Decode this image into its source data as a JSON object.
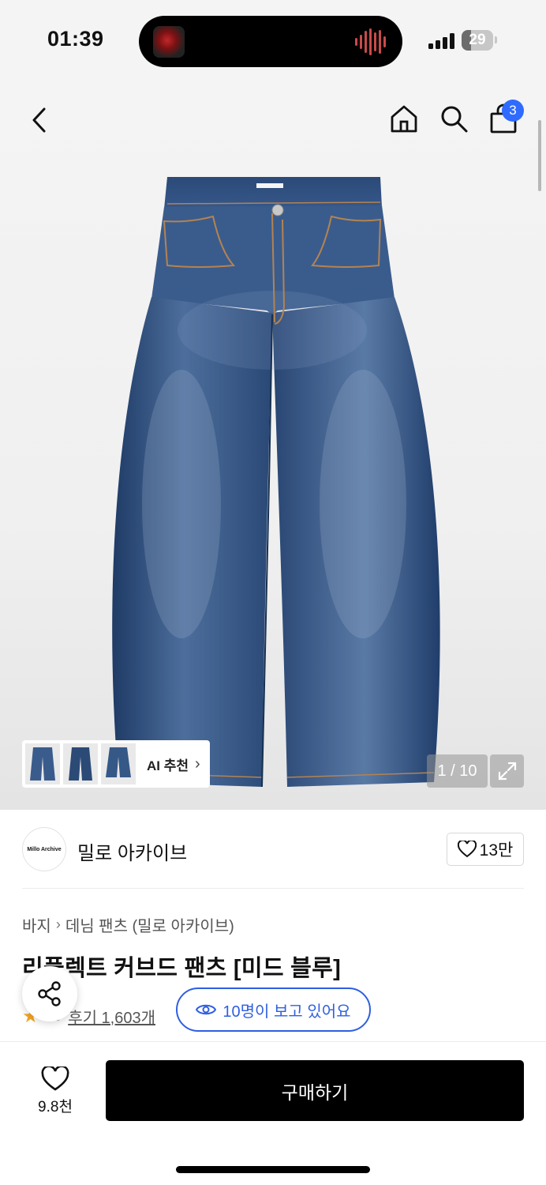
{
  "status_bar": {
    "time": "01:39",
    "battery": "29",
    "battery_level": 0.29
  },
  "header": {
    "cart_count": "3"
  },
  "gallery": {
    "counter": "1 / 10",
    "ai_recommend_label": "AI 추천",
    "ai_thumbnails": [
      "jeans-thumb-1",
      "jeans-thumb-2",
      "jeans-thumb-3"
    ]
  },
  "brand": {
    "logo_text": "Millo Archive",
    "name": "밀로 아카이브",
    "likes": "13만"
  },
  "breadcrumb": [
    "바지",
    "데님 팬츠 (밀로 아카이브)"
  ],
  "product": {
    "title": "리플렉트 커브드 팬츠 [미드 블루]",
    "rating": "4.9",
    "rating_visible": ".9",
    "reviews": "후기 1,603개",
    "viewers": "10명이 보고 있어요"
  },
  "bottom_bar": {
    "wish_count": "9.8천",
    "buy_label": "구매하기"
  },
  "colors": {
    "accent_blue": "#2f5fe0",
    "badge_blue": "#2f6bff",
    "star": "#f5a623",
    "denim": "#3a5a88"
  }
}
